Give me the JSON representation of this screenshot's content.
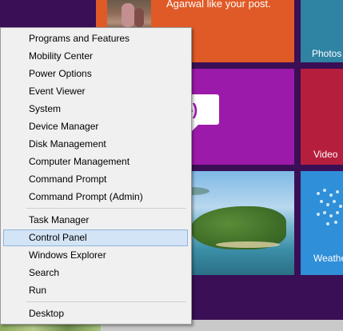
{
  "tiles": {
    "people_text": "Agarwal like your post.",
    "photos_label": "Photos",
    "messaging_glyph": "-)",
    "video_label": "Video",
    "weather_label": "Weathe"
  },
  "menu": {
    "items": [
      {
        "label": "Programs and Features"
      },
      {
        "label": "Mobility Center"
      },
      {
        "label": "Power Options"
      },
      {
        "label": "Event Viewer"
      },
      {
        "label": "System"
      },
      {
        "label": "Device Manager"
      },
      {
        "label": "Disk Management"
      },
      {
        "label": "Computer Management"
      },
      {
        "label": "Command Prompt"
      },
      {
        "label": "Command Prompt (Admin)"
      },
      {
        "label": "Task Manager"
      },
      {
        "label": "Control Panel"
      },
      {
        "label": "Windows Explorer"
      },
      {
        "label": "Search"
      },
      {
        "label": "Run"
      },
      {
        "label": "Desktop"
      }
    ],
    "highlighted_item": "Control Panel"
  },
  "colors": {
    "start_background": "#3a0f56",
    "people_tile": "#e05a27",
    "photos_tile": "#2f83a3",
    "messaging_tile": "#9c1aa9",
    "video_tile": "#b51e3d",
    "weather_tile": "#2f8fd8",
    "menu_background": "#f0f0f0",
    "highlight": "#d3e4f6"
  }
}
